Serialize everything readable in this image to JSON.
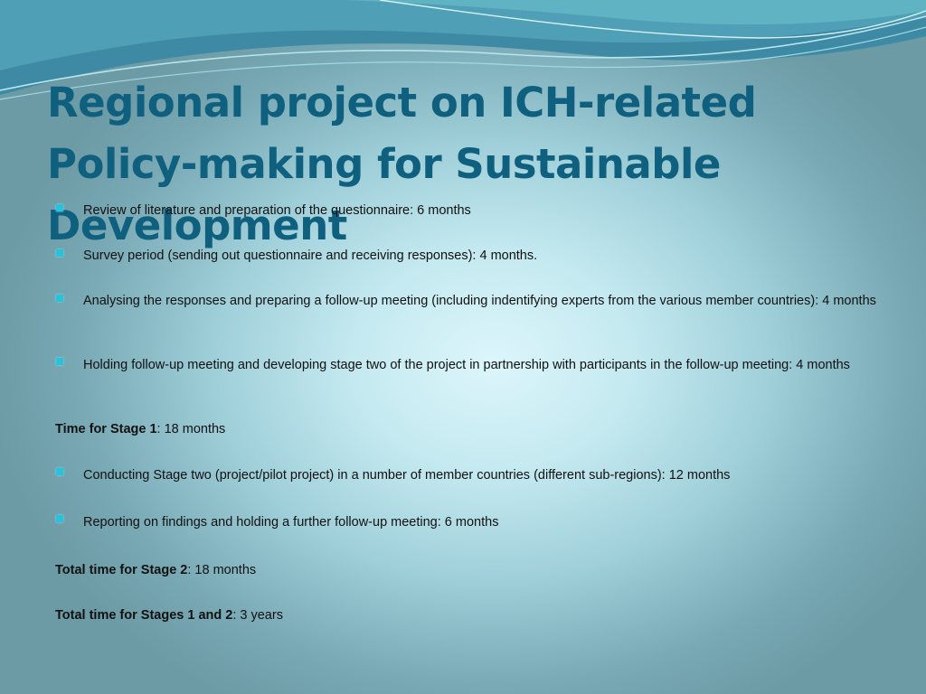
{
  "title": "Regional project on ICH-related Policy-making for Sustainable Development",
  "accent_color": "#29c1dc",
  "title_color": "#0f5f7f",
  "bullets": [
    "Review of literature and preparation of the questionnaire: 6 months",
    "Survey period (sending out questionnaire and receiving responses): 4 months.",
    "Analysing the responses and preparing a follow-up meeting (including indentifying experts from the various member countries): 4 months",
    "Holding follow-up meeting and developing stage two of the project in partnership with participants in the follow-up meeting: 4 months",
    "Conducting Stage two (project/pilot project) in a number of member countries (different sub-regions): 12 months",
    "Reporting on findings and holding a further follow-up meeting: 6 months"
  ],
  "summaries": [
    {
      "label": "Time for Stage 1",
      "value": ": 18 months"
    },
    {
      "label": "Total time for Stage 2",
      "value": ": 18 months"
    },
    {
      "label": "Total time for Stages 1 and 2",
      "value": ": 3 years"
    }
  ]
}
